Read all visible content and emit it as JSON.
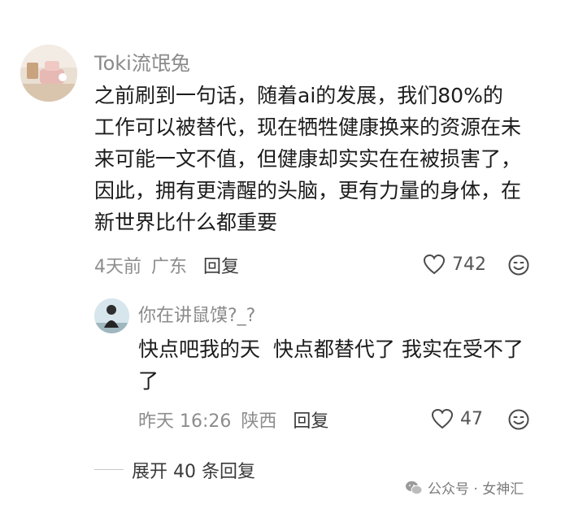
{
  "comment": {
    "username": "Toki流氓兔",
    "text_lines": [
      "之前刷到一句话，随着ai的发展，我们80%的",
      "工作可以被替代，现在牺牲健康换来的资源在未",
      "来可能一文不值，但健康却实实在在被损害了，",
      "因此，拥有更清醒的头脑，更有力量的身体，在",
      "新世界比什么都重要"
    ],
    "time": "4天前",
    "location": "广东",
    "reply_label": "回复",
    "like_count": "742",
    "icons": {
      "like": "heart-icon",
      "emoji": "smiley-icon"
    }
  },
  "reply": {
    "username": "你在讲鼠馍?_?",
    "text_lines": [
      "快点吧我的天  快点都替代了 我实在受不了",
      "了"
    ],
    "time": "昨天 16:26",
    "location": "陕西",
    "reply_label": "回复",
    "like_count": "47"
  },
  "expand": {
    "label": "展开 40 条回复"
  },
  "watermark": {
    "text": "公众号 · 女神汇"
  }
}
